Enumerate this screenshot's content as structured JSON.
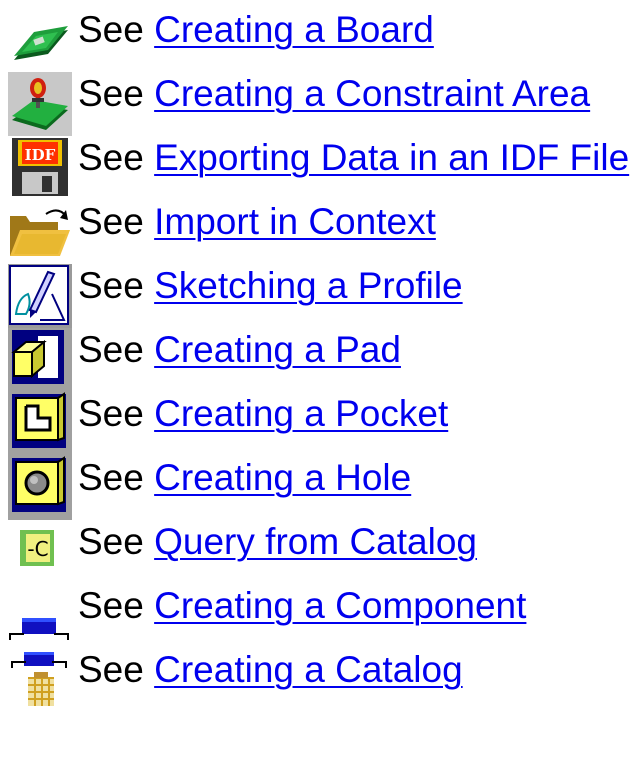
{
  "items": [
    {
      "prefix": "See",
      "link": "Creating a Board",
      "icon": "board-icon"
    },
    {
      "prefix": "See",
      "link": "Creating a Constraint Area",
      "icon": "constraint-area-icon"
    },
    {
      "prefix": "See",
      "link": "Exporting Data in an IDF File",
      "icon": "idf-export-icon"
    },
    {
      "prefix": "See",
      "link": "Import in Context",
      "icon": "open-folder-icon"
    },
    {
      "prefix": "See",
      "link": "Sketching a Profile",
      "icon": "sketcher-icon"
    },
    {
      "prefix": "See",
      "link": "Creating a Pad",
      "icon": "pad-icon"
    },
    {
      "prefix": "See",
      "link": "Creating a Pocket",
      "icon": "pocket-icon"
    },
    {
      "prefix": "See",
      "link": "Creating a Hole",
      "icon": "hole-icon"
    },
    {
      "prefix": "See",
      "link": "Query from Catalog",
      "icon": "catalog-query-icon"
    },
    {
      "prefix": "See",
      "link": "Creating a Component",
      "icon": "component-icon"
    },
    {
      "prefix": "See",
      "link": "Creating a Catalog",
      "icon": "catalog-icon"
    }
  ],
  "icon_text": {
    "idf_label": "IDF",
    "catalog_label": "-C"
  },
  "colors": {
    "link": "#0000ee",
    "text": "#000000",
    "board_green": "#1e9e3c",
    "icon_gray": "#c0c0c0",
    "icon_navy": "#000080",
    "icon_yellow": "#ffff66",
    "folder_yellow": "#e8b830"
  }
}
